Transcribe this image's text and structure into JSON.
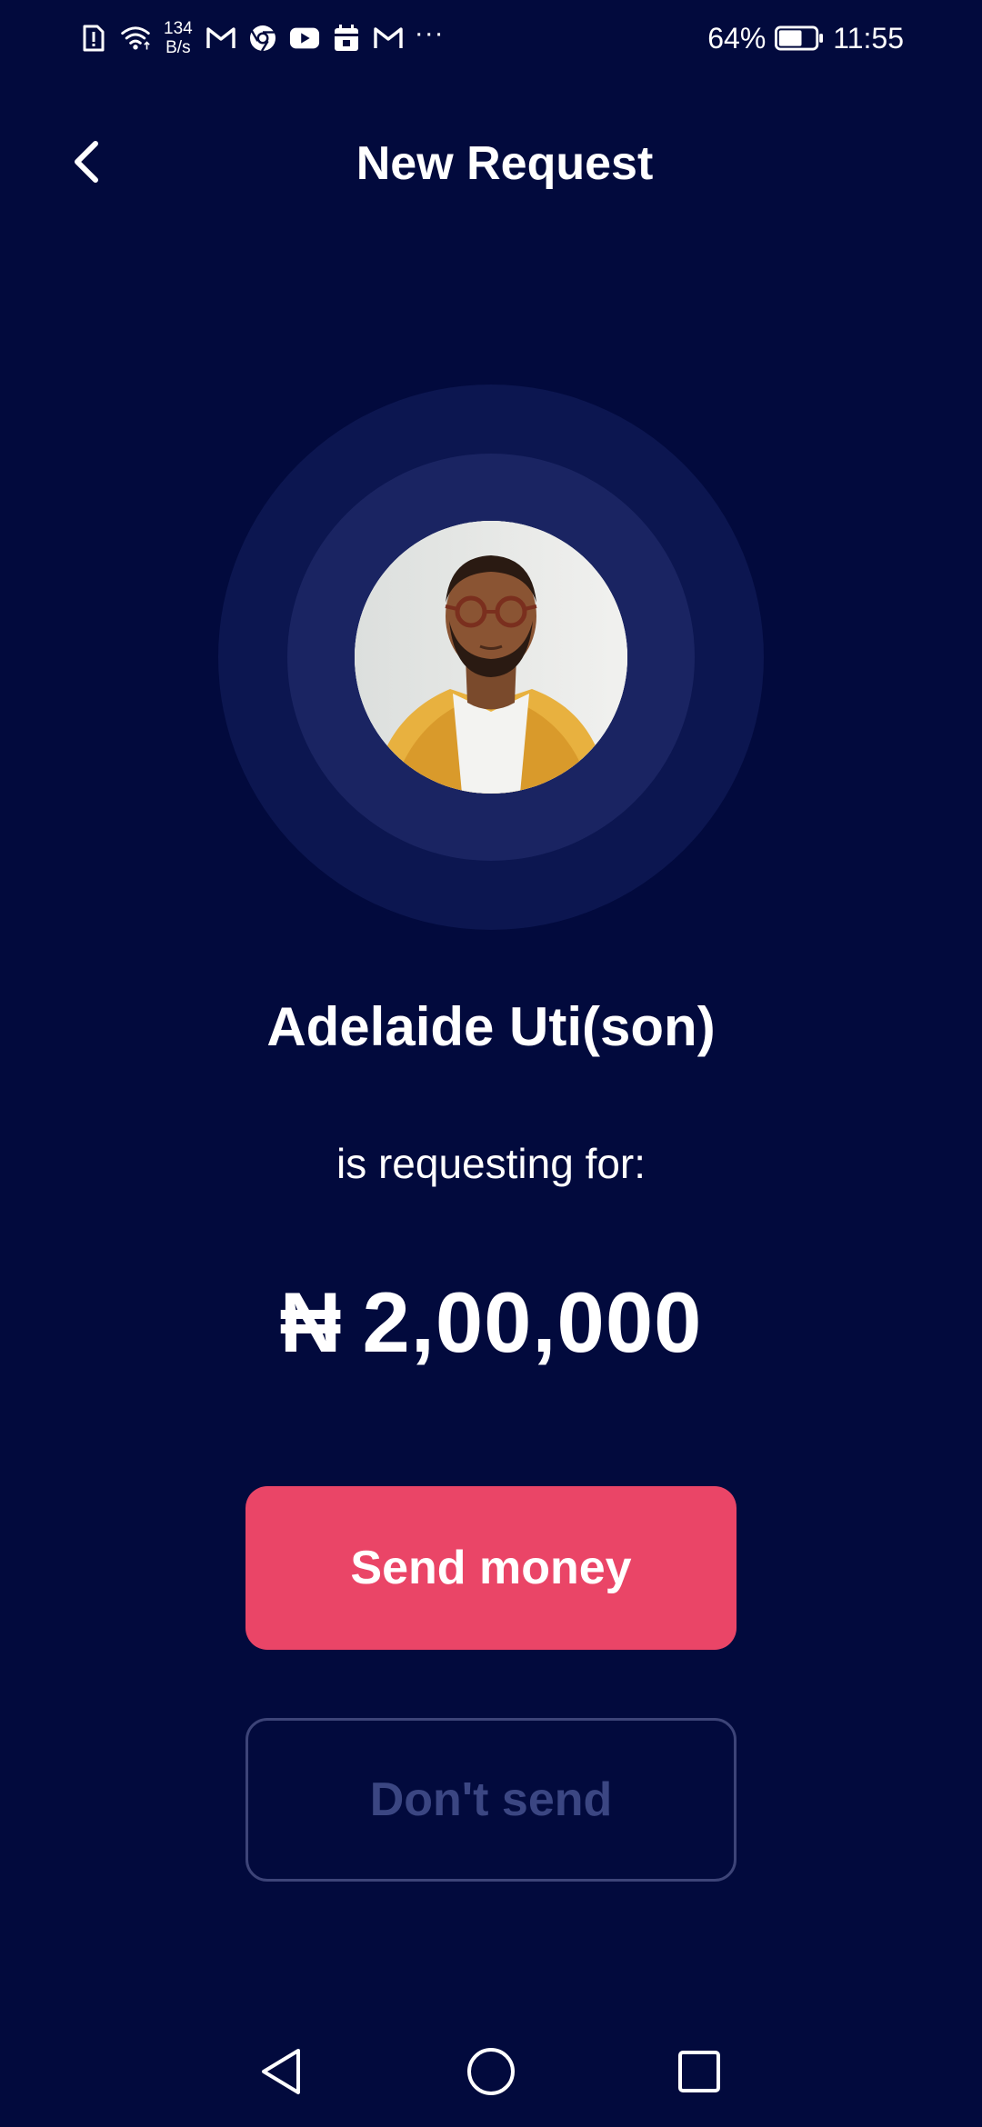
{
  "status_bar": {
    "net_speed_value": "134",
    "net_speed_unit": "B/s",
    "overflow_indicator": "···",
    "battery_percent": "64%",
    "battery_level": 0.64,
    "time": "11:55",
    "icons": [
      "alert-sim-icon",
      "wifi-icon",
      "gmail-icon",
      "chrome-icon",
      "youtube-icon",
      "calendar-icon",
      "gmail-icon"
    ]
  },
  "header": {
    "back_icon": "chevron-left-icon",
    "title": "New Request"
  },
  "request": {
    "requester_name": "Adelaide Uti(son)",
    "message": "is requesting for:",
    "currency_symbol": "₦",
    "amount": "2,00,000"
  },
  "actions": {
    "send_label": "Send money",
    "dont_send_label": "Don't send"
  },
  "colors": {
    "background": "#020a3d",
    "ring_outer": "#0c1650",
    "ring_inner": "#1a2462",
    "primary_button": "#ea4567",
    "secondary_border": "#3d4478",
    "secondary_text": "#3b4682"
  },
  "nav_bar": {
    "back_icon": "triangle-back-icon",
    "home_icon": "circle-home-icon",
    "recents_icon": "square-recents-icon"
  }
}
